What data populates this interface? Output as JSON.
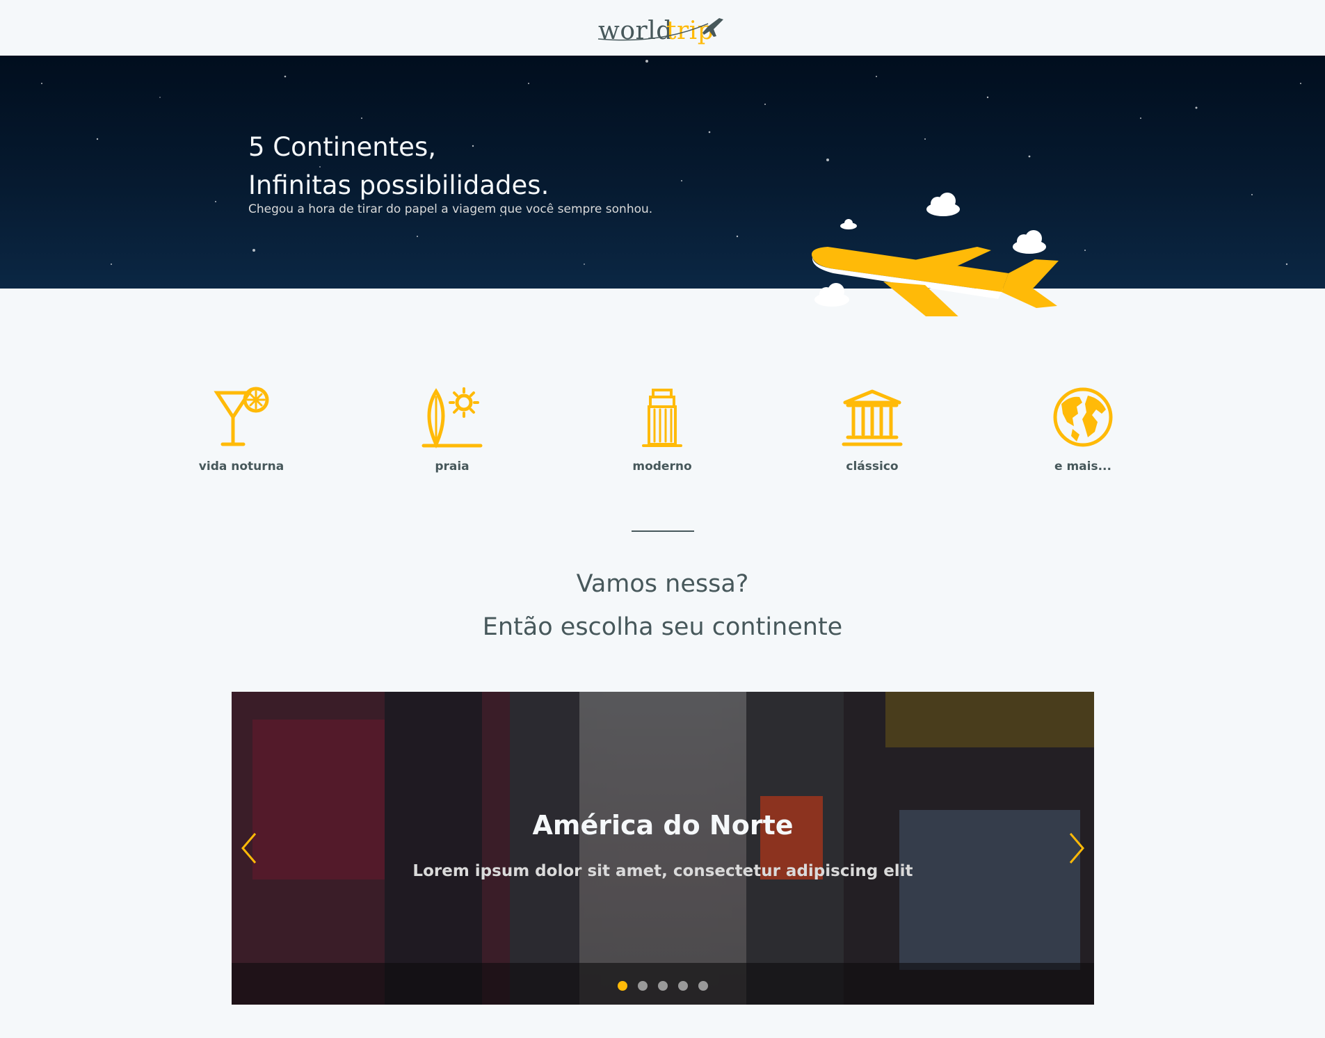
{
  "colors": {
    "highlight": "#FFBA08",
    "dark_text": "#47585B",
    "light_bg": "#F5F8FA",
    "banner_bg": "#010E1E"
  },
  "header": {
    "logo_world": "world",
    "logo_trip": "trip"
  },
  "banner": {
    "title_line1": "5 Continentes,",
    "title_line2": "Infinitas possibilidades.",
    "subtitle": "Chegou a hora de tirar do papel a viagem que você sempre sonhou."
  },
  "travel_types": [
    {
      "label": "vida noturna",
      "icon": "cocktail-icon"
    },
    {
      "label": "praia",
      "icon": "surf-sun-icon"
    },
    {
      "label": "moderno",
      "icon": "skyscraper-icon"
    },
    {
      "label": "clássico",
      "icon": "museum-icon"
    },
    {
      "label": "e mais...",
      "icon": "earth-icon"
    }
  ],
  "cta": {
    "line1": "Vamos nessa?",
    "line2": "Então escolha seu continente"
  },
  "slider": {
    "title": "América do Norte",
    "subtitle": "Lorem ipsum dolor sit amet, consectetur adipiscing elit",
    "active_index": 0
  }
}
